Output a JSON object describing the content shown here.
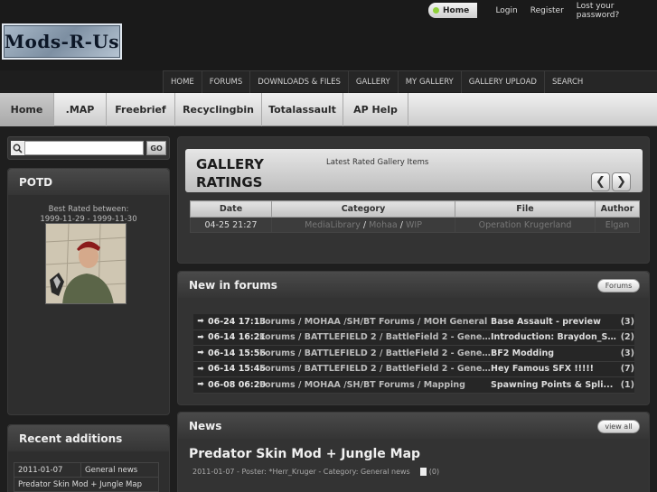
{
  "brand": {
    "logo": "Mods-R-Us"
  },
  "userbar": {
    "home": "Home",
    "login": "Login",
    "register": "Register",
    "lost_password": "Lost your password?"
  },
  "topnav": [
    "HOME",
    "FORUMS",
    "DOWNLOADS & FILES",
    "GALLERY",
    "MY GALLERY",
    "GALLERY UPLOAD",
    "SEARCH"
  ],
  "tabs": [
    "Home",
    ".MAP",
    "Freebrief",
    "Recyclingbin",
    "Totalassault",
    "AP Help"
  ],
  "search": {
    "value": "",
    "placeholder": "",
    "go": "GO"
  },
  "potd": {
    "title": "POTD",
    "caption_line1": "Best Rated between:",
    "caption_line2": "1999-11-29 - 1999-11-30"
  },
  "recent": {
    "title": "Recent additions",
    "rows": [
      {
        "date": "2011-01-07",
        "category": "General news"
      },
      {
        "title": "Predator Skin Mod + Jungle Map"
      }
    ]
  },
  "gallery": {
    "title_line1": "GALLERY",
    "title_line2": "RATINGS",
    "subtitle": "Latest Rated Gallery Items",
    "prev": "❮",
    "next": "❯",
    "headers": [
      "Date",
      "Category",
      "File",
      "Author"
    ],
    "row": {
      "date": "04-25 21:27",
      "cat1": "MediaLibrary",
      "cat2": "Mohaa",
      "cat3": "WIP",
      "file": "Operation Krugerland",
      "author": "Elgan"
    }
  },
  "forums": {
    "title": "New in forums",
    "button": "Forums",
    "rows": [
      {
        "date": "06-24 17:13",
        "path": "Forums / MOHAA /SH/BT Forums / MOH General",
        "topic": "Base Assault - preview",
        "count": "(3)"
      },
      {
        "date": "06-14 16:21",
        "path": "Forums / BATTLEFIELD 2 / BattleField 2 - Gener...",
        "topic": "Introduction: Braydon_SFX",
        "count": "(2)"
      },
      {
        "date": "06-14 15:56",
        "path": "Forums / BATTLEFIELD 2 / BattleField 2 - Gener...",
        "topic": "BF2 Modding",
        "count": "(3)"
      },
      {
        "date": "06-14 15:45",
        "path": "Forums / BATTLEFIELD 2 / BattleField 2 - Gener...",
        "topic": "Hey Famous SFX !!!!!",
        "count": "(7)"
      },
      {
        "date": "06-08 06:20",
        "path": "Forums / MOHAA /SH/BT Forums / Mapping",
        "topic": "Spawning Points & Spli...",
        "count": "(1)"
      }
    ]
  },
  "news": {
    "title": "News",
    "button": "view all",
    "item_title": "Predator Skin Mod + Jungle Map",
    "meta": "2011-01-07 - Poster: *Herr_Kruger - Category: General news",
    "comments": "(0)"
  }
}
